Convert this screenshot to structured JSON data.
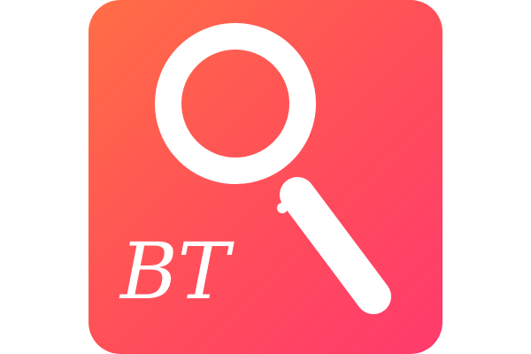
{
  "app_icon": {
    "label": "BT",
    "icon": "magnifier-search-icon",
    "colors": {
      "gradient_start": "#ff6e45",
      "gradient_end": "#ff3a6c",
      "foreground": "#ffffff"
    }
  }
}
